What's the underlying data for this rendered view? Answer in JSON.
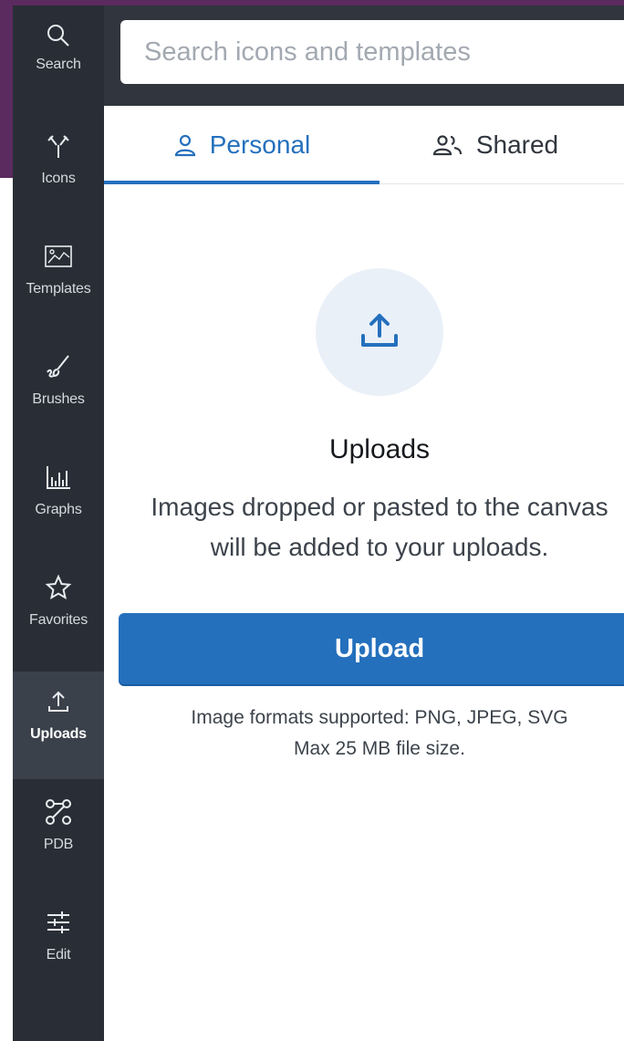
{
  "rail": {
    "items": [
      {
        "label": "Search",
        "icon": "search-icon"
      },
      {
        "label": "Icons",
        "icon": "icons-icon"
      },
      {
        "label": "Templates",
        "icon": "templates-icon"
      },
      {
        "label": "Brushes",
        "icon": "brush-icon"
      },
      {
        "label": "Graphs",
        "icon": "graphs-icon"
      },
      {
        "label": "Favorites",
        "icon": "star-icon"
      },
      {
        "label": "Uploads",
        "icon": "upload-icon",
        "active": true
      },
      {
        "label": "PDB",
        "icon": "pdb-icon"
      },
      {
        "label": "Edit",
        "icon": "sliders-icon"
      }
    ]
  },
  "search": {
    "placeholder": "Search icons and templates"
  },
  "tabs": [
    {
      "label": "Personal",
      "icon": "person-icon",
      "active": true
    },
    {
      "label": "Shared",
      "icon": "people-icon"
    }
  ],
  "uploads": {
    "title": "Uploads",
    "description": "Images dropped or pasted to the canvas will be added to your uploads.",
    "button_label": "Upload",
    "formats_note": "Image formats supported: PNG, JPEG, SVG",
    "size_note": "Max 25 MB file size."
  },
  "colors": {
    "accent": "#2470bd",
    "rail_bg": "#292e36",
    "rail_active": "#3b414b",
    "topbar_bg": "#31363e",
    "backdrop": "#5b2a5f"
  }
}
